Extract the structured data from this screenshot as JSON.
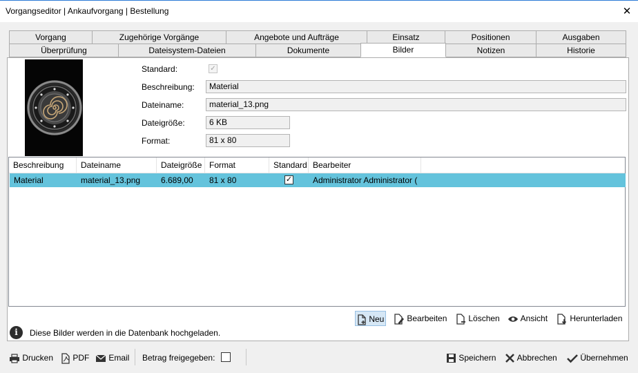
{
  "window": {
    "title": "Vorgangseditor | Ankaufvorgang | Bestellung",
    "close_glyph": "✕"
  },
  "tabs_row1": [
    {
      "label": "Vorgang"
    },
    {
      "label": "Zugehörige Vorgänge"
    },
    {
      "label": "Angebote und Aufträge"
    },
    {
      "label": "Einsatz"
    },
    {
      "label": "Positionen"
    },
    {
      "label": "Ausgaben"
    }
  ],
  "tabs_row2": [
    {
      "label": "Überprüfung"
    },
    {
      "label": "Dateisystem-Dateien"
    },
    {
      "label": "Dokumente"
    },
    {
      "label": "Bilder",
      "active": true
    },
    {
      "label": "Notizen"
    },
    {
      "label": "Historie"
    }
  ],
  "details": {
    "standard_label": "Standard:",
    "standard_checked": true,
    "beschreibung_label": "Beschreibung:",
    "beschreibung_value": "Material",
    "dateiname_label": "Dateiname:",
    "dateiname_value": "material_13.png",
    "dateigroesse_label": "Dateigröße:",
    "dateigroesse_value": "6 KB",
    "format_label": "Format:",
    "format_value": "81 x 80"
  },
  "grid": {
    "columns": [
      "Beschreibung",
      "Dateiname",
      "Dateigröße",
      "Format",
      "Standard",
      "Bearbeiter"
    ],
    "rows": [
      {
        "beschreibung": "Material",
        "dateiname": "material_13.png",
        "dateigroesse": "6.689,00",
        "format": "81 x 80",
        "standard_checked": true,
        "bearbeiter": "Administrator Administrator (",
        "selected": true,
        "selection_color": "#64c3dc"
      }
    ]
  },
  "actions": {
    "neu": "Neu",
    "bearbeiten": "Bearbeiten",
    "loeschen": "Löschen",
    "ansicht": "Ansicht",
    "herunterladen": "Herunterladen"
  },
  "info": {
    "icon_glyph": "i",
    "text": "Diese Bilder werden in die Datenbank hochgeladen."
  },
  "bottom": {
    "drucken": "Drucken",
    "pdf": "PDF",
    "email": "Email",
    "betrag_label": "Betrag freigegeben:",
    "betrag_checked": false,
    "speichern": "Speichern",
    "abbrechen": "Abbrechen",
    "uebernehmen": "Übernehmen"
  },
  "colors": {
    "accent": "#2b79d6",
    "selection": "#64c3dc",
    "tab_bg": "#e9e9e9"
  },
  "check_glyph": "✓"
}
